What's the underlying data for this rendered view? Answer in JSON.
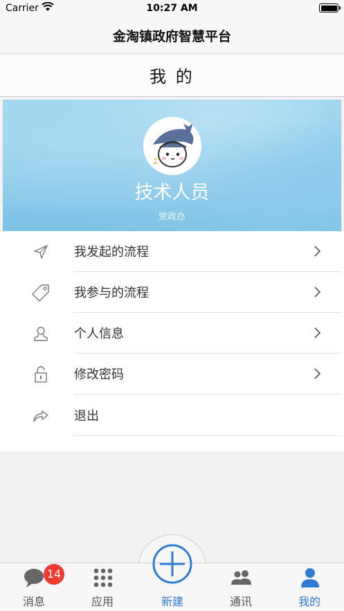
{
  "status_bar": {
    "carrier": "Carrier",
    "time": "10:27 AM"
  },
  "app": {
    "title": "金淘镇政府智慧平台"
  },
  "page": {
    "title": "我 的"
  },
  "profile": {
    "name": "技术人员",
    "department": "党政办"
  },
  "menu": {
    "items": [
      {
        "label": "我发起的流程",
        "icon": "send-icon"
      },
      {
        "label": "我参与的流程",
        "icon": "tag-icon"
      },
      {
        "label": "个人信息",
        "icon": "user-icon"
      },
      {
        "label": "修改密码",
        "icon": "lock-icon"
      },
      {
        "label": "退出",
        "icon": "share-forward-icon"
      }
    ]
  },
  "tabs": {
    "messages": {
      "label": "消息",
      "badge": "14"
    },
    "apps": {
      "label": "应用"
    },
    "new": {
      "label": "新建"
    },
    "contacts": {
      "label": "通讯"
    },
    "mine": {
      "label": "我的"
    }
  },
  "colors": {
    "accent": "#2f7bd6",
    "badge": "#f23b2e",
    "banner": "#8fcbea"
  }
}
